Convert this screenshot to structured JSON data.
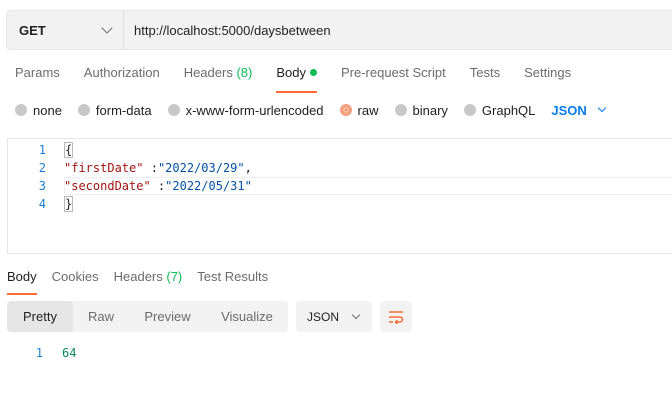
{
  "request": {
    "method": "GET",
    "url": "http://localhost:5000/daysbetween"
  },
  "request_tabs": [
    {
      "label": "Params"
    },
    {
      "label": "Authorization"
    },
    {
      "label": "Headers",
      "count": "(8)"
    },
    {
      "label": "Body",
      "active": true,
      "indicator": "green-dot"
    },
    {
      "label": "Pre-request Script"
    },
    {
      "label": "Tests"
    },
    {
      "label": "Settings"
    }
  ],
  "body_types": [
    {
      "label": "none"
    },
    {
      "label": "form-data"
    },
    {
      "label": "x-www-form-urlencoded"
    },
    {
      "label": "raw",
      "selected": true
    },
    {
      "label": "binary"
    },
    {
      "label": "GraphQL"
    }
  ],
  "body_format": "JSON",
  "editor": {
    "lines": [
      {
        "num": "1",
        "text": "{"
      },
      {
        "num": "2",
        "key": "\"firstDate\"",
        "sep": " :",
        "value": "\"2022/03/29\"",
        "trail": ","
      },
      {
        "num": "3",
        "key": "\"secondDate\"",
        "sep": " :",
        "value": "\"2022/05/31\"",
        "trail": ""
      },
      {
        "num": "4",
        "text": "}"
      }
    ]
  },
  "response_tabs": [
    {
      "label": "Body",
      "active": true
    },
    {
      "label": "Cookies"
    },
    {
      "label": "Headers",
      "count": "(7)"
    },
    {
      "label": "Test Results"
    }
  ],
  "view_modes": [
    "Pretty",
    "Raw",
    "Preview",
    "Visualize"
  ],
  "active_view_mode": "Pretty",
  "response_format": "JSON",
  "response": {
    "line_num": "1",
    "value": "64"
  },
  "colors": {
    "accent": "#ff6c37",
    "success": "#0cbb52",
    "link": "#097bed"
  },
  "icons": {
    "method_dropdown": "chevron-down-icon",
    "format_dropdown": "chevron-down-icon",
    "wrap": "wrap-lines-icon"
  }
}
